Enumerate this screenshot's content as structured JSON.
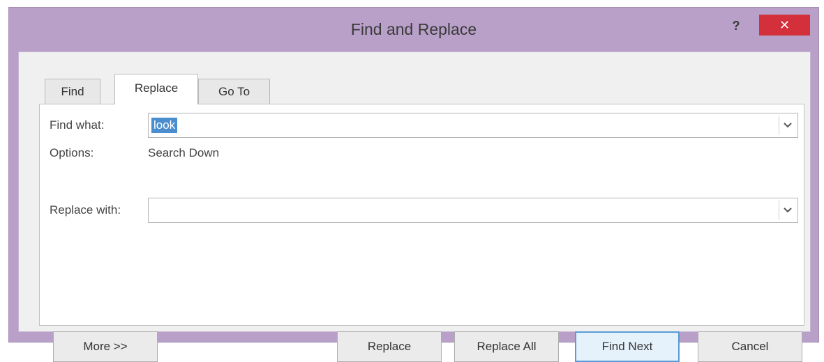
{
  "window": {
    "title": "Find and Replace",
    "help_label": "?",
    "close_label": "✕"
  },
  "tabs": [
    {
      "label": "Find",
      "active": false
    },
    {
      "label": "Replace",
      "active": true
    },
    {
      "label": "Go To",
      "active": false
    }
  ],
  "find": {
    "label": "Find what:",
    "value": "look"
  },
  "options": {
    "label": "Options:",
    "value": "Search Down"
  },
  "replace": {
    "label": "Replace with:",
    "value": ""
  },
  "buttons": {
    "more": "More >>",
    "replace": "Replace",
    "replace_all": "Replace All",
    "find_next": "Find Next",
    "cancel": "Cancel"
  },
  "icons": {
    "dropdown": "chevron-down-icon"
  },
  "colors": {
    "frame": "#b8a0c8",
    "close": "#d4303c",
    "selection": "#4a8ecf",
    "default_button_border": "#5a9bd8"
  }
}
